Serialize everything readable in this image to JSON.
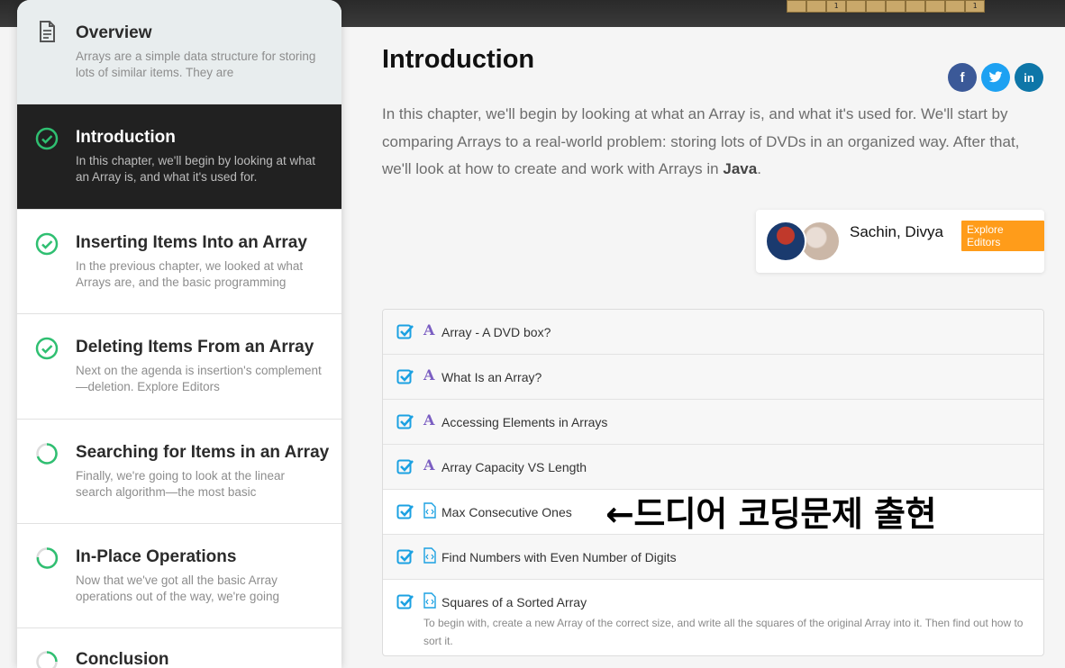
{
  "banner": {
    "grid_cells": [
      "",
      "",
      "1",
      "",
      "",
      "",
      "",
      "",
      "",
      "1"
    ]
  },
  "sidebar": {
    "chapters": [
      {
        "title": "Overview",
        "desc": "Arrays are a simple data structure for storing lots of similar items. They are",
        "status": "document"
      },
      {
        "title": "Introduction",
        "desc": "In this chapter, we'll begin by looking at what an Array is, and what it's used for.",
        "status": "complete"
      },
      {
        "title": "Inserting Items Into an Array",
        "desc": "In the previous chapter, we looked at what Arrays are, and the basic programming",
        "status": "complete"
      },
      {
        "title": "Deleting Items From an Array",
        "desc": "Next on the agenda is insertion's complement—deletion. Explore Editors",
        "status": "complete"
      },
      {
        "title": "Searching for Items in an Array",
        "desc": "Finally, we're going to look at the linear search algorithm—the most basic",
        "status": "partial"
      },
      {
        "title": "In-Place Operations",
        "desc": "Now that we've got all the basic Array operations out of the way, we're going",
        "status": "partial"
      },
      {
        "title": "Conclusion",
        "desc": "",
        "status": "partial"
      }
    ]
  },
  "content": {
    "title": "Introduction",
    "intro_text": "In this chapter, we'll begin by looking at what an Array is, and what it's used for. We'll start by comparing Arrays to a real-world problem: storing lots of DVDs in an organized way. After that, we'll look at how to create and work with Arrays in ",
    "intro_bold": "Java",
    "intro_end": ".",
    "share": {
      "facebook": "f",
      "twitter": "t",
      "linkedin": "in"
    },
    "editors": {
      "names": "Sachin, Divya",
      "explore_label": "Explore Editors"
    },
    "items": [
      {
        "type": "article",
        "label": "Array - A DVD box?",
        "sub": ""
      },
      {
        "type": "article",
        "label": "What Is an Array?",
        "sub": ""
      },
      {
        "type": "article",
        "label": "Accessing Elements in Arrays",
        "sub": ""
      },
      {
        "type": "article",
        "label": "Array Capacity VS Length",
        "sub": ""
      },
      {
        "type": "code",
        "label": "Max Consecutive Ones",
        "sub": ""
      },
      {
        "type": "code",
        "label": "Find Numbers with Even Number of Digits",
        "sub": ""
      },
      {
        "type": "code",
        "label": "Squares of a Sorted Array",
        "sub": "To begin with, create a new Array of the correct size, and write all the squares of the original Array into it. Then find out how to sort it."
      }
    ]
  },
  "annotation": {
    "text": "←드디어 코딩문제 출현"
  },
  "colors": {
    "check": "#2fbf71",
    "partial": "#2fbf71",
    "checkbox": "#1ba1e2",
    "active_bg": "#212121",
    "explore": "#ff9c1a"
  }
}
